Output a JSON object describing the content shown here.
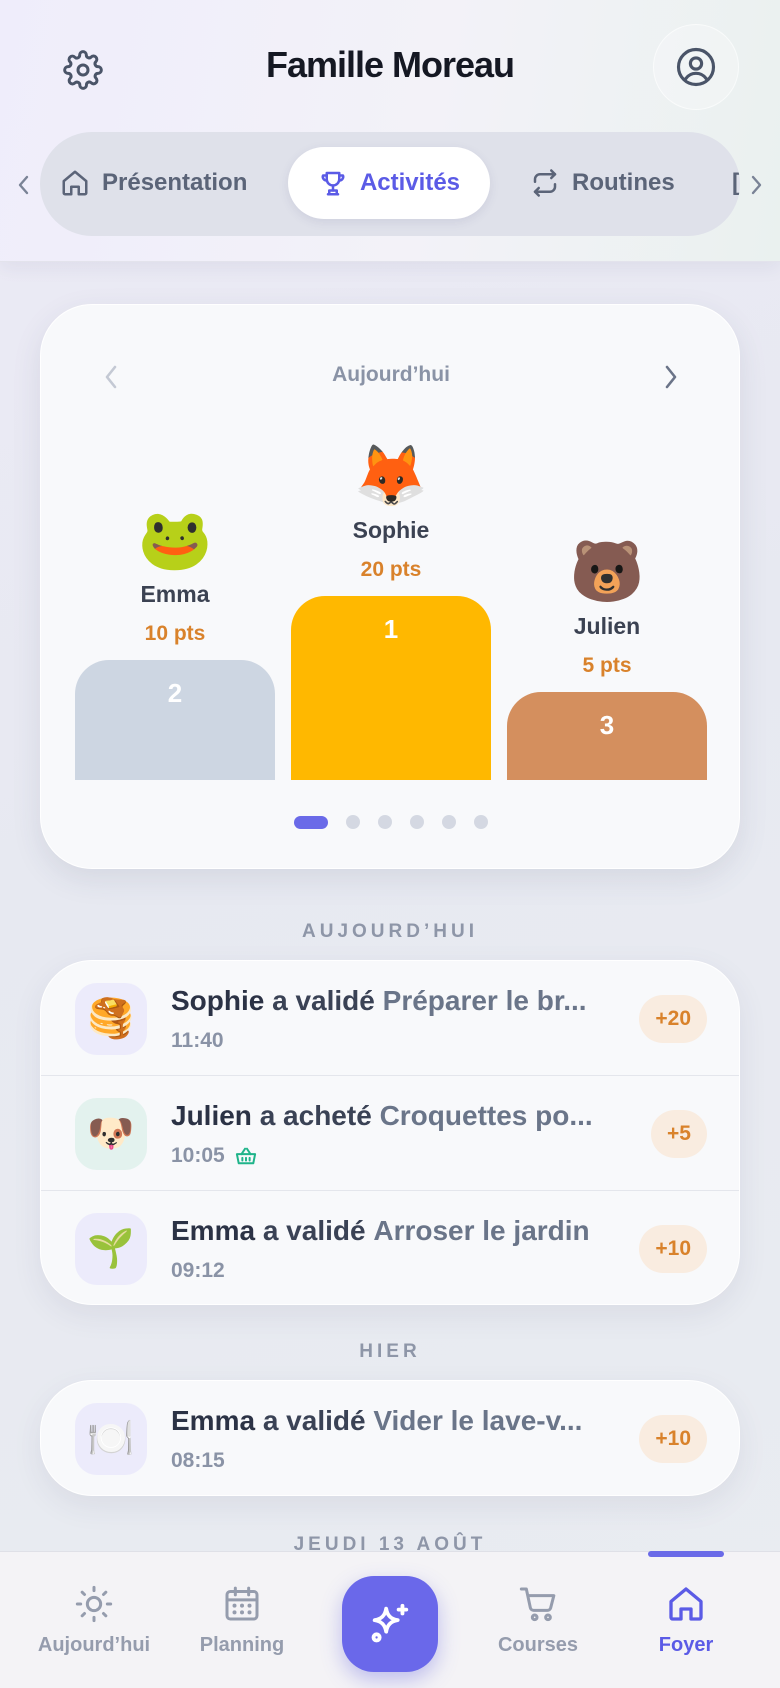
{
  "header": {
    "title": "Famille Moreau",
    "settings_icon": "gear-icon",
    "profile_icon": "user-circle-icon"
  },
  "tabs": [
    {
      "label": "Présentation",
      "icon": "home-icon",
      "active": false
    },
    {
      "label": "Activités",
      "icon": "trophy-icon",
      "active": true
    },
    {
      "label": "Routines",
      "icon": "repeat-icon",
      "active": false
    },
    {
      "label": "[",
      "icon": "",
      "active": false
    }
  ],
  "podium": {
    "period": "Aujourd’hui",
    "members": [
      {
        "rank": "2",
        "emoji": "🐸",
        "name": "Emma",
        "points": "10 pts"
      },
      {
        "rank": "1",
        "emoji": "🦊",
        "name": "Sophie",
        "points": "20 pts"
      },
      {
        "rank": "3",
        "emoji": "🐻",
        "name": "Julien",
        "points": "5 pts"
      }
    ],
    "pages": 6,
    "active_page": 1
  },
  "sections": [
    {
      "label": "AUJOURD’HUI",
      "items": [
        {
          "emoji": "🥞",
          "who": "Sophie",
          "verb": "a validé",
          "what": "Préparer le br...",
          "time": "11:40",
          "points": "+20",
          "icon_bg": "#ecebfb",
          "has_cart": false
        },
        {
          "emoji": "🐶",
          "who": "Julien",
          "verb": "a acheté",
          "what": "Croquettes po...",
          "time": "10:05",
          "points": "+5",
          "icon_bg": "#e3f2ee",
          "has_cart": true
        },
        {
          "emoji": "🌱",
          "who": "Emma",
          "verb": "a validé",
          "what": "Arroser le jardin",
          "time": "09:12",
          "points": "+10",
          "icon_bg": "#ecebfb",
          "has_cart": false
        }
      ]
    },
    {
      "label": "HIER",
      "items": [
        {
          "emoji": "🍽️",
          "who": "Emma",
          "verb": "a validé",
          "what": "Vider le lave-v...",
          "time": "08:15",
          "points": "+10",
          "icon_bg": "#ecebfb",
          "has_cart": false
        }
      ]
    }
  ],
  "more_section_label": "JEUDI 13 AOÛT",
  "bottom_nav": [
    {
      "label": "Aujourd’hui",
      "icon": "sun-icon",
      "active": false
    },
    {
      "label": "Planning",
      "icon": "calendar-icon",
      "active": false
    },
    {
      "label": "",
      "icon": "sparkles-icon",
      "active": false
    },
    {
      "label": "Courses",
      "icon": "cart-icon",
      "active": false
    },
    {
      "label": "Foyer",
      "icon": "home-icon",
      "active": true
    }
  ],
  "colors": {
    "accent": "#6a6ae8",
    "gold": "#ffb800",
    "silver": "#cdd6e2",
    "bronze": "#d48f5e",
    "points": "#d9822b"
  }
}
